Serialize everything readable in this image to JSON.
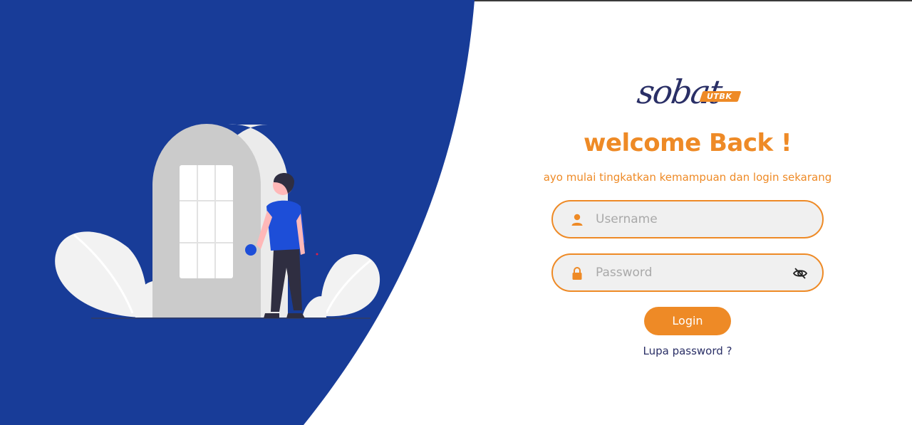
{
  "brand": {
    "logo_script": "sobat",
    "logo_badge": "UTBK"
  },
  "welcome": {
    "title": "welcome Back !",
    "subtitle": "ayo mulai tingkatkan kemampuan dan login sekarang"
  },
  "form": {
    "username": {
      "placeholder": "Username",
      "value": "",
      "icon": "user-icon"
    },
    "password": {
      "placeholder": "Password",
      "value": "",
      "icon": "lock-icon",
      "toggle_icon": "eye-slash-icon"
    },
    "login_label": "Login",
    "forgot_label": "Lupa password ?"
  },
  "colors": {
    "primary_blue": "#183c98",
    "accent_orange": "#ee8a26",
    "navy_text": "#2a2f66",
    "field_background": "#f0f0f0"
  }
}
